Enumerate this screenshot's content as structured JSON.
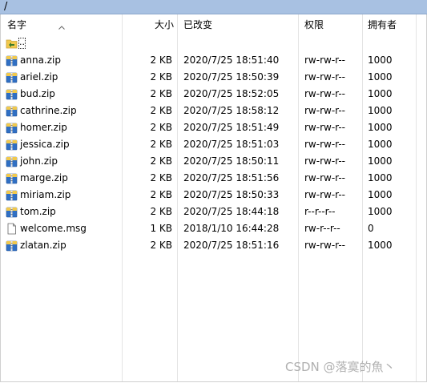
{
  "path": "/",
  "columns": {
    "name": "名字",
    "size": "大小",
    "modified": "已改变",
    "permissions": "权限",
    "owner": "拥有者"
  },
  "parent_entry": "..",
  "files": [
    {
      "name": "anna.zip",
      "size": "2 KB",
      "modified": "2020/7/25 18:51:40",
      "permissions": "rw-rw-r--",
      "owner": "1000",
      "icon": "zip-archive-icon"
    },
    {
      "name": "ariel.zip",
      "size": "2 KB",
      "modified": "2020/7/25 18:50:39",
      "permissions": "rw-rw-r--",
      "owner": "1000",
      "icon": "zip-archive-icon"
    },
    {
      "name": "bud.zip",
      "size": "2 KB",
      "modified": "2020/7/25 18:52:05",
      "permissions": "rw-rw-r--",
      "owner": "1000",
      "icon": "zip-archive-icon"
    },
    {
      "name": "cathrine.zip",
      "size": "2 KB",
      "modified": "2020/7/25 18:58:12",
      "permissions": "rw-rw-r--",
      "owner": "1000",
      "icon": "zip-archive-icon"
    },
    {
      "name": "homer.zip",
      "size": "2 KB",
      "modified": "2020/7/25 18:51:49",
      "permissions": "rw-rw-r--",
      "owner": "1000",
      "icon": "zip-archive-icon"
    },
    {
      "name": "jessica.zip",
      "size": "2 KB",
      "modified": "2020/7/25 18:51:03",
      "permissions": "rw-rw-r--",
      "owner": "1000",
      "icon": "zip-archive-icon"
    },
    {
      "name": "john.zip",
      "size": "2 KB",
      "modified": "2020/7/25 18:50:11",
      "permissions": "rw-rw-r--",
      "owner": "1000",
      "icon": "zip-archive-icon"
    },
    {
      "name": "marge.zip",
      "size": "2 KB",
      "modified": "2020/7/25 18:51:56",
      "permissions": "rw-rw-r--",
      "owner": "1000",
      "icon": "zip-archive-icon"
    },
    {
      "name": "miriam.zip",
      "size": "2 KB",
      "modified": "2020/7/25 18:50:33",
      "permissions": "rw-rw-r--",
      "owner": "1000",
      "icon": "zip-archive-icon"
    },
    {
      "name": "tom.zip",
      "size": "2 KB",
      "modified": "2020/7/25 18:44:18",
      "permissions": "r--r--r--",
      "owner": "1000",
      "icon": "zip-archive-icon"
    },
    {
      "name": "welcome.msg",
      "size": "1 KB",
      "modified": "2018/1/10 16:44:28",
      "permissions": "rw-r--r--",
      "owner": "0",
      "icon": "blank-document-icon"
    },
    {
      "name": "zlatan.zip",
      "size": "2 KB",
      "modified": "2020/7/25 18:51:16",
      "permissions": "rw-rw-r--",
      "owner": "1000",
      "icon": "zip-archive-icon"
    }
  ],
  "watermark": "CSDN @落寞的魚丶",
  "colors": {
    "path_bar": "#a8c1e2",
    "folder_yellow": "#f2c94c",
    "zip_blue": "#2f6fc4"
  }
}
